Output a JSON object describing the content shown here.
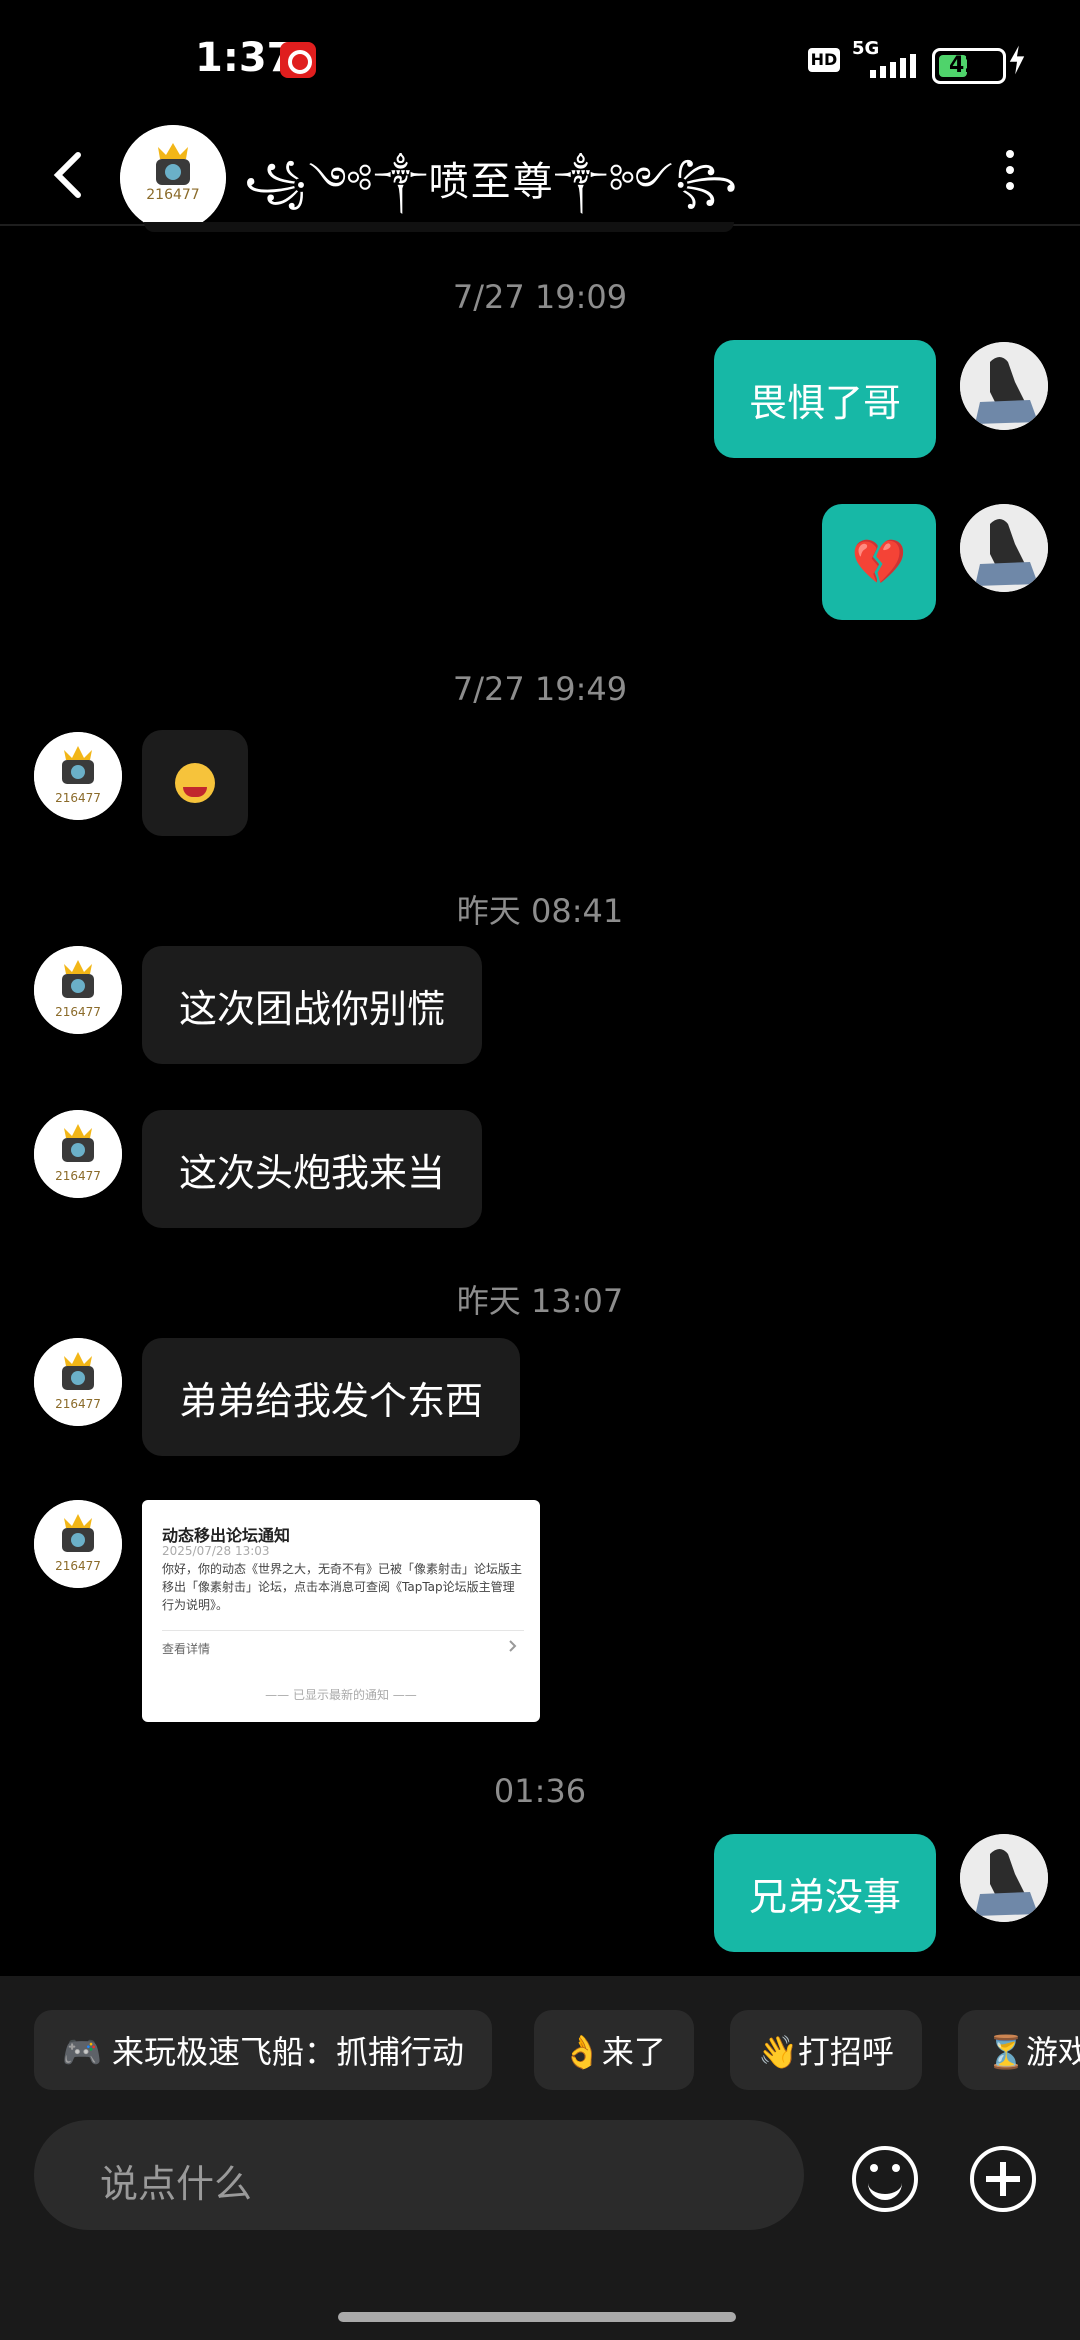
{
  "status": {
    "time": "1:37",
    "hd": "HD",
    "network": "5G",
    "battery": "42"
  },
  "header": {
    "title": "꧁༺༒喷至尊༒༻꧂",
    "avatar_text": "216477"
  },
  "timestamps": {
    "t1": "7/27  19:09",
    "t2": "7/27  19:49",
    "t3": "昨天  08:41",
    "t4": "昨天  13:07",
    "t5": "01:36"
  },
  "messages": {
    "m1": "畏惧了哥",
    "m2": "💔",
    "m3": "这次团战你别慌",
    "m4": "这次头炮我来当",
    "m5": "弟弟给我发个东西",
    "m6": "兄弟没事"
  },
  "notice": {
    "title": "动态移出论坛通知",
    "date": "2025/07/28 13:03",
    "body": "你好，你的动态《世界之大，无奇不有》已被「像素射击」论坛版主移出「像素射击」论坛，点击本消息可查阅《TapTap论坛版主管理行为说明》。",
    "link": "查看详情",
    "footer": "—— 已显示最新的通知 ——"
  },
  "quick_replies": {
    "chip1": "🎮 来玩极速飞船：抓捕行动",
    "chip2": "👌来了",
    "chip3": "👋打招呼",
    "chip4": "⏳游戏"
  },
  "input": {
    "placeholder": "说点什么"
  }
}
